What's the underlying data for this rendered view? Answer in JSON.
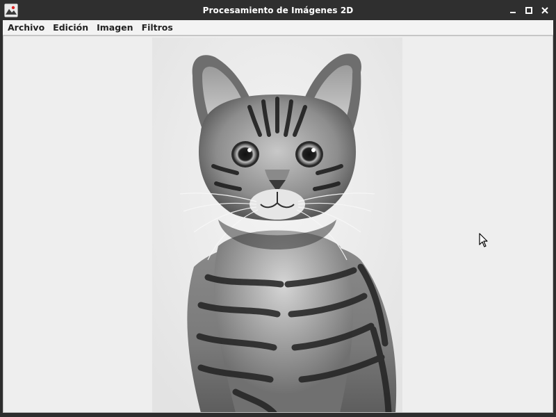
{
  "window": {
    "title": "Procesamiento de Imágenes 2D",
    "app_icon": "image-editor-app-icon",
    "controls": {
      "minimize_icon": "minimize-icon",
      "maximize_icon": "maximize-icon",
      "close_icon": "close-icon"
    }
  },
  "menubar": {
    "items": [
      {
        "label": "Archivo"
      },
      {
        "label": "Edición"
      },
      {
        "label": "Imagen"
      },
      {
        "label": "Filtros"
      }
    ]
  },
  "canvas": {
    "image_subject": "grayscale-tabby-cat-photo",
    "background_color": "#eeeeee"
  },
  "colors": {
    "titlebar": "#2f2f2f",
    "titlebar_text": "#ffffff",
    "menubar": "#f3f3f3",
    "content": "#eeeeee"
  }
}
